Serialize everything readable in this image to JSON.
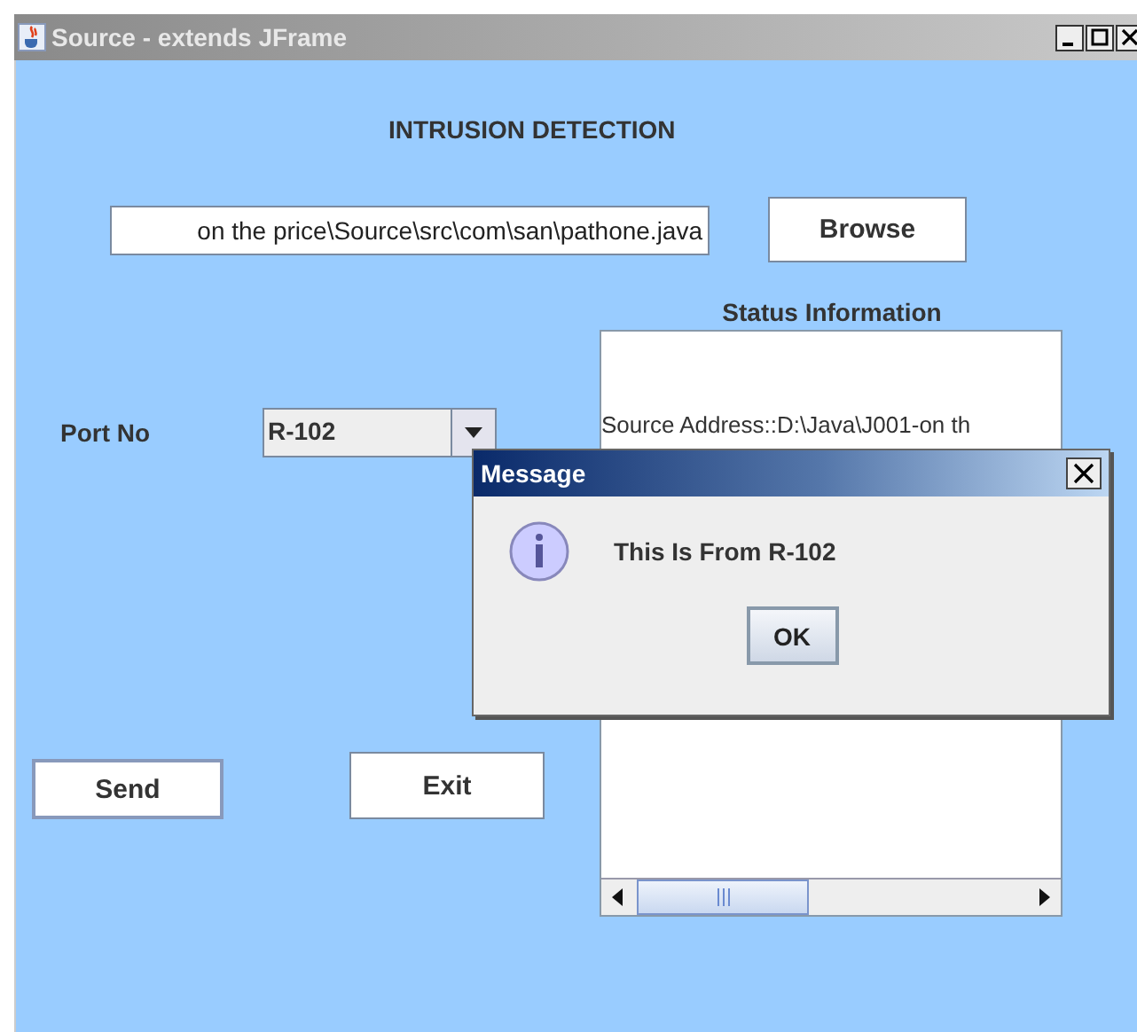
{
  "window": {
    "title": "Source - extends JFrame"
  },
  "heading": "INTRUSION DETECTION",
  "path_field": {
    "value": "on the price\\Source\\src\\com\\san\\pathone.java"
  },
  "browse_button": "Browse",
  "status": {
    "label": "Status Information",
    "text": "Source Address::D:\\Java\\J001-on th"
  },
  "port": {
    "label": "Port No",
    "value": "R-102"
  },
  "buttons": [
    "Send",
    "Exit"
  ],
  "dialog": {
    "title": "Message",
    "message": "This Is From R-102",
    "button": "OK"
  }
}
